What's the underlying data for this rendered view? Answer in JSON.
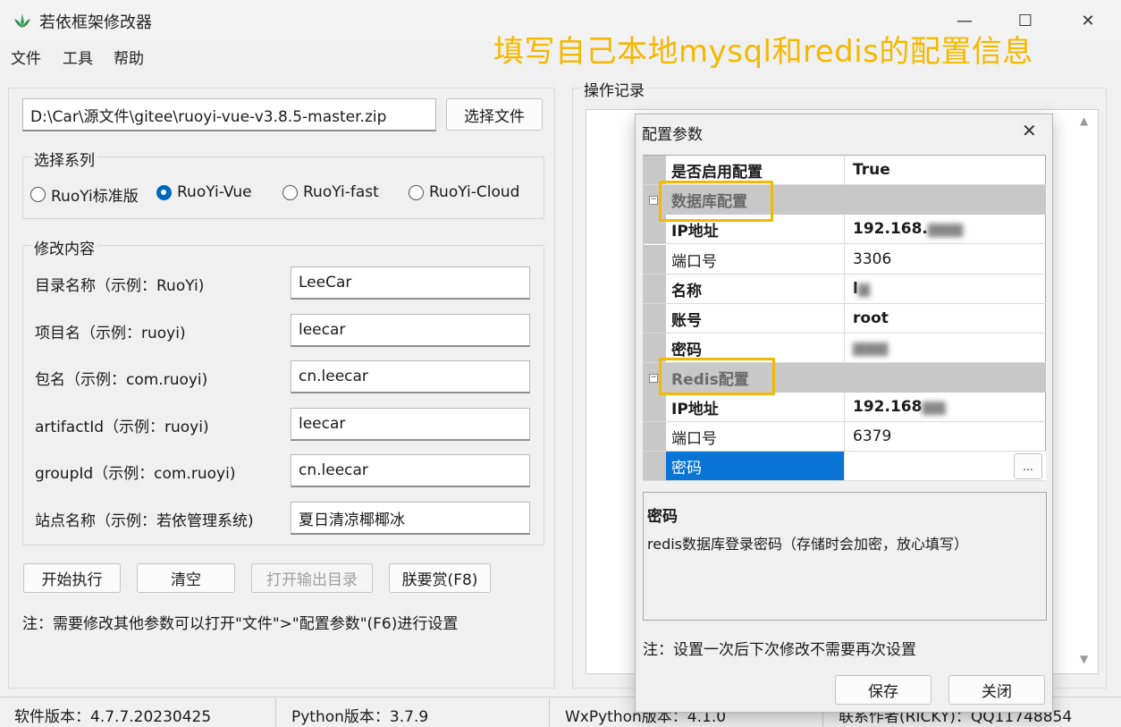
{
  "window": {
    "title": "若依框架修改器",
    "minimize": "—",
    "maximize": "☐",
    "close": "✕"
  },
  "menu": {
    "file": "文件",
    "tools": "工具",
    "help": "帮助"
  },
  "annotation": "填写自己本地mysql和redis的配置信息",
  "file_path": "D:\\Car\\源文件\\gitee\\ruoyi-vue-v3.8.5-master.zip",
  "choose_file": "选择文件",
  "series": {
    "title": "选择系列",
    "options": [
      "RuoYi标准版",
      "RuoYi-Vue",
      "RuoYi-fast",
      "RuoYi-Cloud"
    ],
    "selected": "RuoYi-Vue"
  },
  "modify": {
    "title": "修改内容",
    "fields": [
      {
        "label": "目录名称（示例：RuoYi)",
        "value": "LeeCar"
      },
      {
        "label": "项目名（示例：ruoyi)",
        "value": "leecar"
      },
      {
        "label": "包名（示例：com.ruoyi)",
        "value": "cn.leecar"
      },
      {
        "label": "artifactId（示例：ruoyi)",
        "value": "leecar"
      },
      {
        "label": "groupId（示例：com.ruoyi)",
        "value": "cn.leecar"
      },
      {
        "label": "站点名称（示例：若依管理系统)",
        "value": "夏日清凉椰椰冰"
      }
    ]
  },
  "actions": {
    "start": "开始执行",
    "clear": "清空",
    "open_output": "打开输出目录",
    "reward": "朕要赏(F8)"
  },
  "note": "注：需要修改其他参数可以打开\"文件\">\"配置参数\"(F6)进行设置",
  "log": {
    "title": "操作记录"
  },
  "status": {
    "software": "软件版本：4.7.7.20230425",
    "python": "Python版本：3.7.9",
    "wx": "WxPython版本：4.1.0",
    "contact": "联系作者(RICKY)：QQ11748854"
  },
  "dialog": {
    "title": "配置参数",
    "close": "✕",
    "rows": [
      {
        "key": "是否启用配置",
        "value": "True",
        "type": "prop",
        "bold": true
      },
      {
        "key": "数据库配置",
        "value": "",
        "type": "cat"
      },
      {
        "key": "IP地址",
        "value": "192.168.",
        "type": "prop",
        "bold": true,
        "blur": true
      },
      {
        "key": "端口号",
        "value": "3306",
        "type": "prop"
      },
      {
        "key": "名称",
        "value": "l",
        "type": "prop",
        "bold": true,
        "blur": true
      },
      {
        "key": "账号",
        "value": "root",
        "type": "prop",
        "bold": true
      },
      {
        "key": "密码",
        "value": "",
        "type": "prop",
        "bold": true,
        "blur": true
      },
      {
        "key": "Redis配置",
        "value": "",
        "type": "cat"
      },
      {
        "key": "IP地址",
        "value": "192.168",
        "type": "prop",
        "bold": true,
        "blur": true
      },
      {
        "key": "端口号",
        "value": "6379",
        "type": "prop"
      },
      {
        "key": "密码",
        "value": "",
        "type": "prop",
        "selected": true
      }
    ],
    "ellipsis": "...",
    "desc_title": "密码",
    "desc_text": "redis数据库登录密码（存储时会加密，放心填写）",
    "note": "注：设置一次后下次修改不需要再次设置",
    "save": "保存",
    "close_btn": "关闭"
  }
}
